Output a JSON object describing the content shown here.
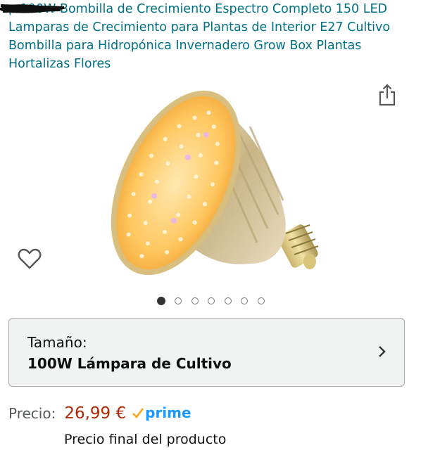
{
  "product": {
    "title": "p 100W Bombilla de Crecimiento Espectro Completo 150 LED Lamparas de Crecimiento para Plantas de Interior E27 Cultivo Bombilla para Hidropónica Invernadero Grow Box Plantas Hortalizas Flores"
  },
  "carousel": {
    "total": 7,
    "active_index": 0
  },
  "icons": {
    "share": "share-icon",
    "wishlist": "heart-icon",
    "chevron": "chevron-right-icon",
    "prime": "check-icon"
  },
  "size_selector": {
    "label": "Tamaño:",
    "value": "100W Lámpara de Cultivo"
  },
  "pricing": {
    "label": "Precio:",
    "price": "26,99 €",
    "prime_text": "prime",
    "final_price_note": "Precio final del producto"
  },
  "colors": {
    "link": "#007185",
    "price": "#B12704",
    "prime": "#1A98FF"
  }
}
